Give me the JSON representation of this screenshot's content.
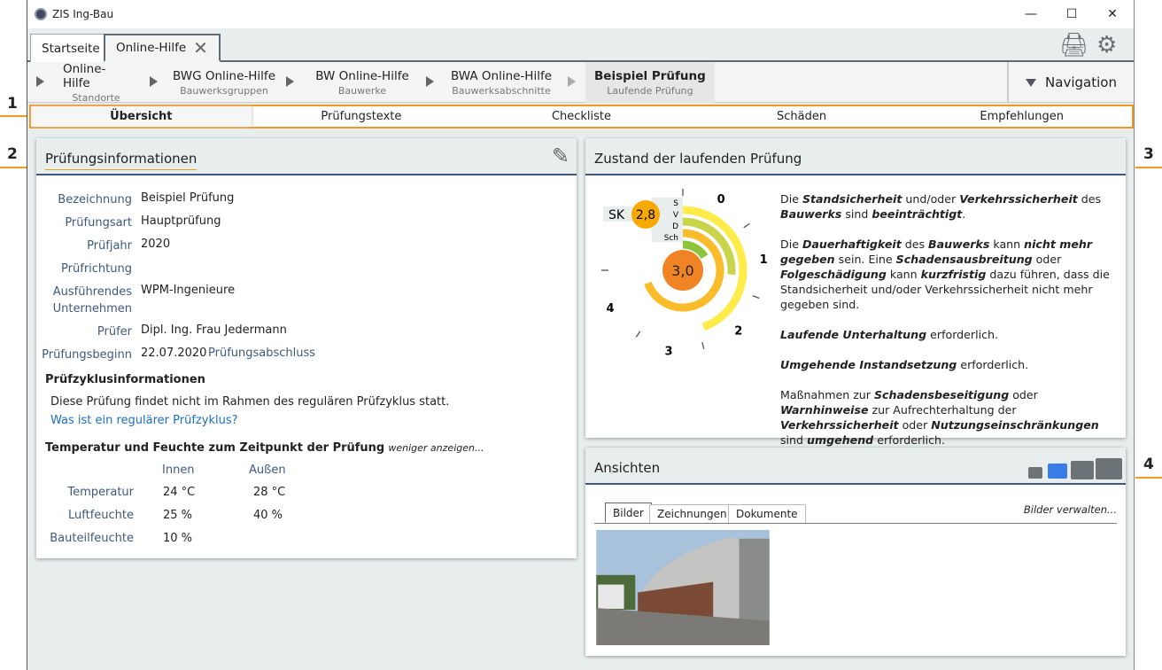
{
  "window": {
    "title": "ZIS Ing-Bau",
    "controls": [
      "minimize",
      "maximize",
      "close"
    ]
  },
  "tabs": [
    {
      "label": "Startseite"
    },
    {
      "label": "Online-Hilfe",
      "closable": true
    }
  ],
  "toolbar": {
    "icons": [
      "printer-icon",
      "gear-icon"
    ]
  },
  "breadcrumb": [
    {
      "title": "Online-Hilfe",
      "sub": "Standorte"
    },
    {
      "title": "BWG Online-Hilfe",
      "sub": "Bauwerksgruppen"
    },
    {
      "title": "BW Online-Hilfe",
      "sub": "Bauwerke"
    },
    {
      "title": "BWA Online-Hilfe",
      "sub": "Bauwerksabschnitte"
    },
    {
      "title": "Beispiel Prüfung",
      "sub": "Laufende Prüfung"
    }
  ],
  "navigation_label": "Navigation",
  "subtabs": [
    "Übersicht",
    "Prüfungstexte",
    "Checkliste",
    "Schäden",
    "Empfehlungen"
  ],
  "markers": [
    "1",
    "2",
    "3",
    "4"
  ],
  "info": {
    "title": "Prüfungsinformationen",
    "fields": [
      {
        "label": "Bezeichnung",
        "value": "Beispiel Prüfung"
      },
      {
        "label": "Prüfungsart",
        "value": "Hauptprüfung"
      },
      {
        "label": "Prüfjahr",
        "value": "2020"
      },
      {
        "label": "Prüfrichtung",
        "value": ""
      },
      {
        "label": "Ausführendes Unternehmen",
        "value": "WPM-Ingenieure"
      },
      {
        "label": "Prüfer",
        "value": "Dipl. Ing. Frau Jedermann"
      },
      {
        "label": "Prüfungsbeginn",
        "value": "22.07.2020"
      }
    ],
    "abschluss_label": "Prüfungsabschluss",
    "zyklus_title": "Prüfzyklusinformationen",
    "zyklus_text": "Diese Prüfung findet nicht im Rahmen des regulären Prüfzyklus statt.",
    "zyklus_link": "Was ist ein regulärer Prüfzyklus?",
    "temp_title": "Temperatur und Feuchte zum Zeitpunkt der Prüfung",
    "temp_toggle": "weniger anzeigen...",
    "cols": [
      "Innen",
      "Außen"
    ],
    "rows": [
      {
        "label": "Temperatur",
        "innen": "24 °C",
        "aussen": "28 °C"
      },
      {
        "label": "Luftfeuchte",
        "innen": "25 %",
        "aussen": "40 %"
      },
      {
        "label": "Bauteilfeuchte",
        "innen": "10 %",
        "aussen": ""
      }
    ]
  },
  "zustand": {
    "title": "Zustand der laufenden Prüfung",
    "gauge": {
      "sk_label": "SK",
      "sk_value": "2,8",
      "center_value": "3,0",
      "ring_labels": [
        "S",
        "V",
        "D",
        "Sch"
      ],
      "scale_labels": [
        "0",
        "1",
        "2",
        "3",
        "4"
      ],
      "colors": {
        "S": "#ffeb4a",
        "V": "#c8d44a",
        "D": "#fbbc2c",
        "Sch": "#8cc43c",
        "center": "#f08424",
        "sk": "#f7a900"
      }
    },
    "paragraphs": [
      [
        {
          "t": "Die "
        },
        {
          "t": "Standsicherheit",
          "b": 1
        },
        {
          "t": " und/oder "
        },
        {
          "t": "Verkehrssicherheit",
          "b": 1
        },
        {
          "t": " des "
        },
        {
          "t": "Bauwerks",
          "b": 1
        },
        {
          "t": " sind "
        },
        {
          "t": "beeinträchtigt",
          "b": 1
        },
        {
          "t": "."
        }
      ],
      [
        {
          "t": "Die "
        },
        {
          "t": "Dauerhaftigkeit",
          "b": 1
        },
        {
          "t": " des "
        },
        {
          "t": "Bauwerks",
          "b": 1
        },
        {
          "t": " kann "
        },
        {
          "t": "nicht mehr gegeben",
          "b": 1
        },
        {
          "t": " sein. Eine "
        },
        {
          "t": "Schadensausbreitung",
          "b": 1
        },
        {
          "t": " oder "
        },
        {
          "t": "Folgeschädigung",
          "b": 1
        },
        {
          "t": " kann "
        },
        {
          "t": "kurzfristig",
          "b": 1
        },
        {
          "t": " dazu führen, dass die Standsicherheit und/oder Verkehrssicherheit nicht mehr gegeben sind."
        }
      ],
      [
        {
          "t": "Laufende Unterhaltung",
          "b": 1
        },
        {
          "t": " erforderlich."
        }
      ],
      [
        {
          "t": "Umgehende Instandsetzung",
          "b": 1
        },
        {
          "t": " erforderlich."
        }
      ],
      [
        {
          "t": "Maßnahmen zur "
        },
        {
          "t": "Schadensbeseitigung",
          "b": 1
        },
        {
          "t": " oder "
        },
        {
          "t": "Warnhinweise",
          "b": 1
        },
        {
          "t": " zur Aufrechterhaltung der "
        },
        {
          "t": "Verkehrssicherheit",
          "b": 1
        },
        {
          "t": " oder "
        },
        {
          "t": "Nutzungseinschränkungen",
          "b": 1
        },
        {
          "t": " sind "
        },
        {
          "t": "umgehend",
          "b": 1
        },
        {
          "t": " erforderlich."
        }
      ]
    ]
  },
  "ansichten": {
    "title": "Ansichten",
    "tabs": [
      "Bilder",
      "Zeichnungen",
      "Dokumente"
    ],
    "manage": "Bilder verwalten...",
    "size_icons": [
      "image-small-icon",
      "image-medium-icon",
      "image-large-icon",
      "image-xlarge-icon"
    ]
  }
}
